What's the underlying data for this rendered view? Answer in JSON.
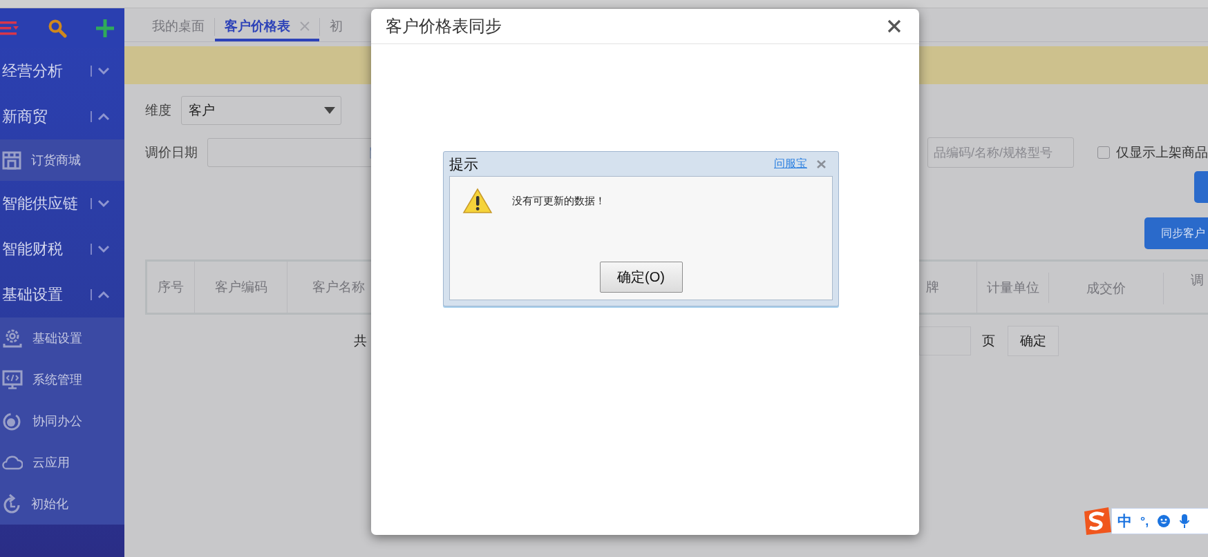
{
  "sidebar": {
    "items": [
      {
        "label": "经营分析",
        "expanded": false
      },
      {
        "label": "新商贸",
        "expanded": true,
        "children": [
          {
            "label": "订货商城"
          }
        ]
      },
      {
        "label": "智能供应链",
        "expanded": false
      },
      {
        "label": "智能财税",
        "expanded": false
      },
      {
        "label": "基础设置",
        "expanded": true,
        "children": [
          {
            "label": "基础设置"
          },
          {
            "label": "系统管理"
          },
          {
            "label": "协同办公"
          },
          {
            "label": "云应用"
          },
          {
            "label": "初始化"
          }
        ]
      }
    ]
  },
  "tabs": [
    {
      "label": "我的桌面",
      "selected": false,
      "closable": false
    },
    {
      "label": "客户价格表",
      "selected": true,
      "closable": true
    },
    {
      "label": "初",
      "selected": false,
      "closable": false
    }
  ],
  "filters": {
    "dimension_label": "维度",
    "dimension_value": "客户",
    "date_label": "调价日期",
    "search_placeholder": "品编码/名称/规格型号",
    "onshelf_checkbox": {
      "label": "仅显示上架商品",
      "checked": false
    }
  },
  "sync_button": "同步客户",
  "table": {
    "columns_left": [
      "序号",
      "客户编码",
      "客户名称"
    ],
    "columns_right": [
      "牌",
      "计量单位",
      "成交价",
      "调"
    ]
  },
  "pagination": {
    "total_prefix": "共",
    "page_label": "页",
    "go_button": "确定"
  },
  "modal": {
    "title": "客户价格表同步",
    "alert": {
      "title": "提示",
      "link": "问服宝",
      "message": "没有可更新的数据！",
      "button": "确定(O)"
    }
  },
  "ime_bar": {
    "language": "中",
    "punctuation": "°,"
  }
}
